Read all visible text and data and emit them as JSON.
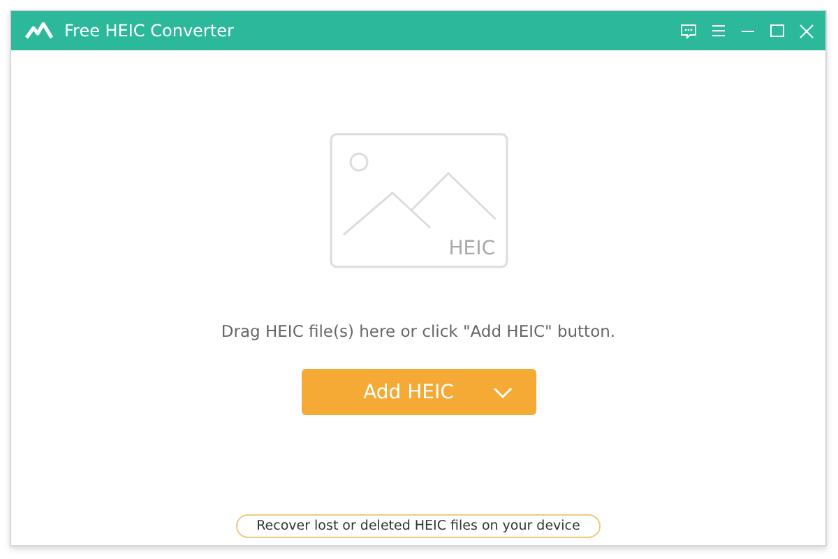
{
  "window": {
    "title": "Free HEIC Converter"
  },
  "drop_area": {
    "image_label": "HEIC",
    "hint": "Drag HEIC file(s) here or click \"Add HEIC\" button."
  },
  "add_button": {
    "label": "Add HEIC"
  },
  "recover_link": {
    "label": "Recover lost or deleted HEIC files on your device"
  }
}
